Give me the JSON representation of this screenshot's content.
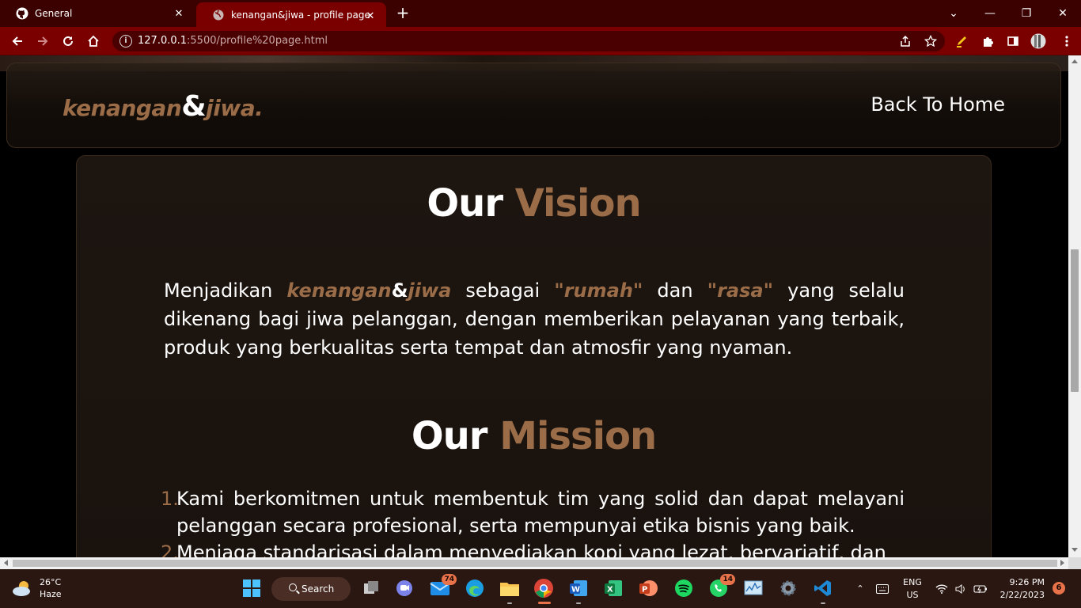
{
  "browser": {
    "tabs": [
      {
        "title": "General",
        "icon": "github-icon"
      },
      {
        "title": "kenangan&jiwa - profile page",
        "icon": "globe-icon"
      }
    ],
    "url_host": "127.0.0.1",
    "url_rest": ":5500/profile%20page.html"
  },
  "page": {
    "brand": {
      "name_left": "kenangan",
      "amp": "&",
      "name_right": "jiwa."
    },
    "nav": {
      "back_home": "Back To Home"
    },
    "vision": {
      "title_plain": "Our",
      "title_accent": "Vision",
      "text_start": "Menjadikan ",
      "brand_left": "kenangan",
      "brand_amp": "&",
      "brand_right": "jiwa",
      "text_mid1": " sebagai ",
      "quote1": "\"rumah\"",
      "text_mid2": " dan ",
      "quote2": "\"rasa\"",
      "text_end": " yang selalu dikenang bagi jiwa pelanggan, dengan memberikan pelayanan yang terbaik, produk yang berkualitas serta tempat dan atmosfir yang nyaman."
    },
    "mission": {
      "title_plain": "Our",
      "title_accent": "Mission",
      "items": [
        {
          "num": "1.",
          "text": "Kami berkomitmen untuk membentuk tim yang solid dan dapat melayani pelanggan secara profesional, serta mempunyai etika bisnis yang baik."
        },
        {
          "num": "2.",
          "text": "Menjaga standarisasi dalam menyediakan kopi yang lezat, bervariatif, dan"
        }
      ]
    }
  },
  "taskbar": {
    "weather": {
      "temp": "26°C",
      "condition": "Haze"
    },
    "search_label": "Search",
    "mail_badge": "74",
    "whatsapp_badge": "14",
    "lang_top": "ENG",
    "lang_bottom": "US",
    "time": "9:26 PM",
    "date": "2/22/2023",
    "notifications": "6"
  },
  "colors": {
    "accent": "#9a6c48",
    "chrome_dark": "#3b0000",
    "chrome": "#7a0000",
    "taskbar": "#2b1711"
  }
}
